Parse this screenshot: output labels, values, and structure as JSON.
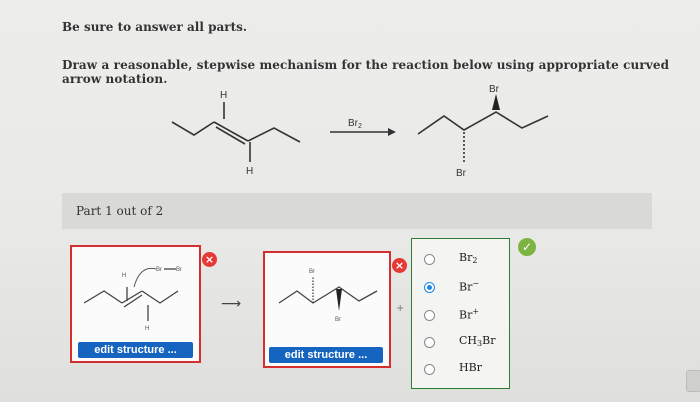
{
  "instructions": {
    "line1": "Be sure to answer all parts.",
    "line2": "Draw a reasonable, stepwise mechanism for the reaction below using appropriate curved arrow notation."
  },
  "reaction": {
    "reactant_top_H": "H",
    "reactant_bottom_H": "H",
    "reagent": "Br",
    "reagent_sub": "2",
    "product_top_Br": "Br",
    "product_bottom_Br": "Br"
  },
  "part": {
    "label": "Part 1 out of 2"
  },
  "structure1": {
    "edit_label": "edit structure ...",
    "atom_H_left": "H",
    "atom_H_bottom": "H",
    "atom_Br1": "Br",
    "atom_Br2": "Br"
  },
  "structure2": {
    "edit_label": "edit structure ...",
    "atom_Br_top": "Br",
    "atom_Br_bottom": "Br"
  },
  "between_arrow": "⟶",
  "plus_sign": "+",
  "choices": [
    {
      "label": "Br",
      "sub": "2",
      "sup": "",
      "selected": false
    },
    {
      "label": "Br",
      "sub": "",
      "sup": "−",
      "selected": true
    },
    {
      "label": "Br",
      "sub": "",
      "sup": "+",
      "selected": false
    },
    {
      "label": "CH",
      "sub": "3",
      "sup": "",
      "suffix": "Br",
      "selected": false
    },
    {
      "label": "HBr",
      "sub": "",
      "sup": "",
      "selected": false
    }
  ],
  "badges": {
    "wrong_symbol": "×",
    "correct_symbol": "✓"
  },
  "colors": {
    "edit_button": "#1565c0",
    "error": "#d32f2f",
    "correct": "#7cb342",
    "radio_selected": "#1e88e5"
  }
}
